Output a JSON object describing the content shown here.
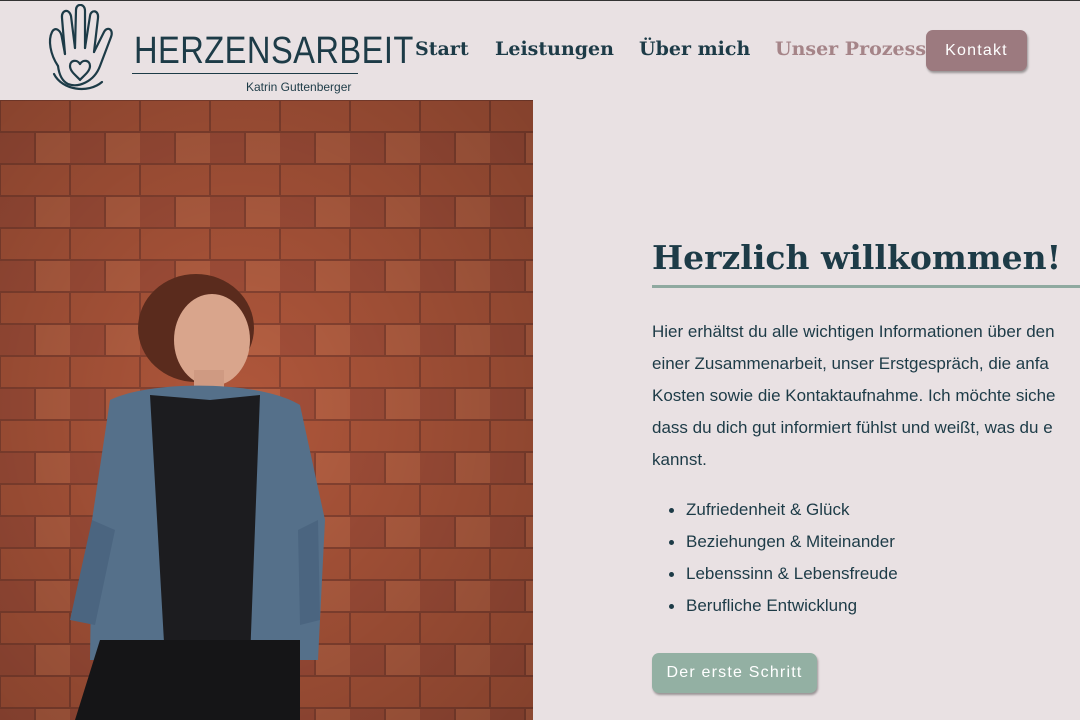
{
  "brand": {
    "name": "HERZENSARBEIT",
    "owner": "Katrin Guttenberger",
    "logo_icon": "hand-heart-icon"
  },
  "nav": {
    "items": [
      {
        "label": "Start",
        "active": false
      },
      {
        "label": "Leistungen",
        "active": false
      },
      {
        "label": "Über mich",
        "active": false
      },
      {
        "label": "Unser Prozess",
        "active": true
      }
    ],
    "contact_label": "Kontakt"
  },
  "hero": {
    "image": "portrait-woman-brick-wall",
    "title": "Herzlich willkommen!",
    "intro_lines": [
      "Hier erhältst du alle wichtigen Informationen über den",
      "einer Zusammenarbeit, unser Erstgespräch, die anfa",
      "Kosten sowie die Kontaktaufnahme. Ich möchte siche",
      "dass du dich gut informiert fühlst und weißt, was du e",
      "kannst."
    ],
    "bullets": [
      "Zufriedenheit & Glück",
      "Beziehungen & Miteinander",
      "Lebenssinn & Lebensfreude",
      "Berufliche Entwicklung"
    ],
    "cta_label": "Der erste Schritt"
  },
  "colors": {
    "background": "#e9e1e3",
    "primary_text": "#1d3b47",
    "accent_rose": "#9c7a7f",
    "accent_sage": "#93b0a3"
  }
}
